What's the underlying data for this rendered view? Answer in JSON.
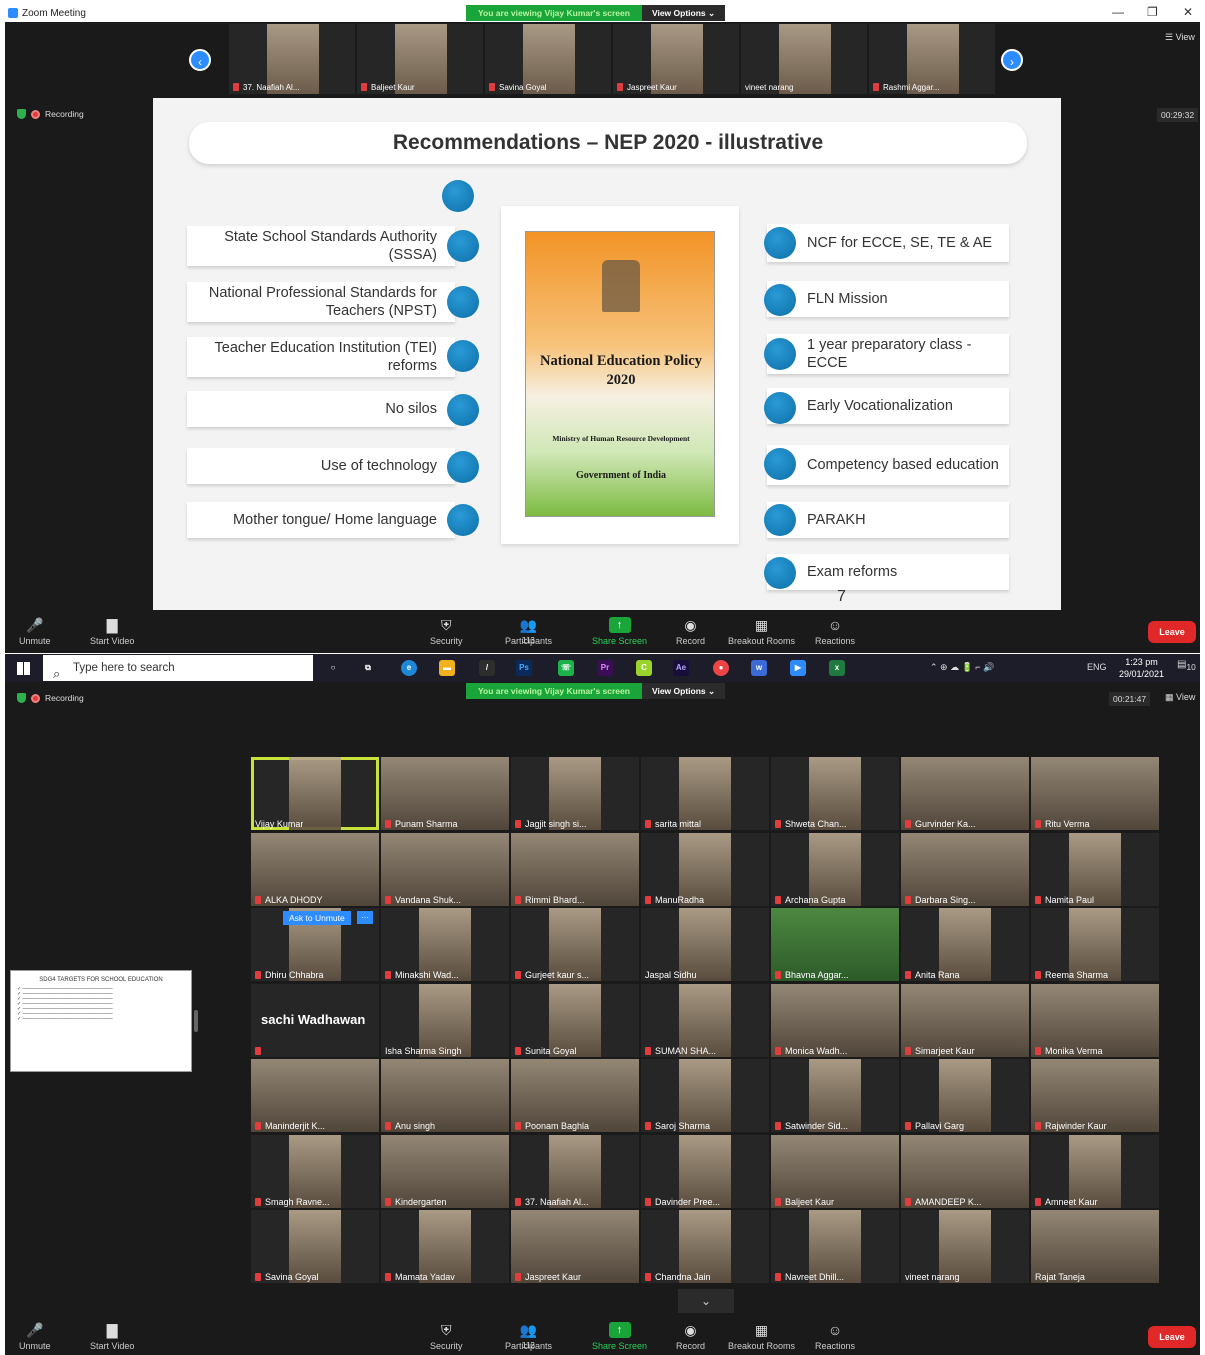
{
  "window": {
    "title": "Zoom Meeting",
    "minimize": "—",
    "restore": "❐",
    "close": "✕"
  },
  "banner": {
    "message": "You are viewing Vijay Kumar's screen",
    "options": "View Options ⌄"
  },
  "top": {
    "view": "View",
    "recording": "Recording",
    "timer": "00:29:32",
    "strip": [
      "37. Naafiah Al...",
      "Baljeet Kaur",
      "Savina Goyal",
      "Jaspreet Kaur",
      "vineet narang",
      "Rashmi Aggar..."
    ]
  },
  "slide": {
    "title": "Recommendations – NEP 2020 - illustrative",
    "left": [
      "State School Standards Authority (SSSA)",
      "National Professional Standards for Teachers (NPST)",
      "Teacher Education Institution (TEI) reforms",
      "No silos",
      "Use of technology",
      "Mother tongue/ Home language"
    ],
    "right": [
      "NCF for ECCE, SE, TE & AE",
      "FLN Mission",
      "1 year preparatory class - ECCE",
      "Early Vocationalization",
      "Competency based education",
      "PARAKH",
      "Exam reforms"
    ],
    "cover": {
      "title": "National Education Policy 2020",
      "ministry": "Ministry of Human Resource Development",
      "govt": "Government of India"
    },
    "page": "7"
  },
  "toolbar_top": {
    "unmute": "Unmute",
    "start_video": "Start Video",
    "security": "Security",
    "participants": "Participants",
    "participants_count": "113",
    "share": "Share Screen",
    "record": "Record",
    "breakout": "Breakout Rooms",
    "reactions": "Reactions",
    "leave": "Leave"
  },
  "taskbar": {
    "search_placeholder": "Type here to search",
    "lang": "ENG",
    "time": "1:23 pm",
    "date": "29/01/2021",
    "notif": "10"
  },
  "bottom": {
    "recording": "Recording",
    "timer": "00:21:47",
    "view": "View",
    "ask_unmute": "Ask to Unmute",
    "more": "···",
    "shared_title": "SDG4 TARGETS FOR SCHOOL EDUCATION",
    "grid": [
      "Vijay Kumar",
      "Punam Sharma",
      "Jagjit singh si...",
      "sarita mittal",
      "Shweta Chan...",
      "Gurvinder Ka...",
      "Ritu Verma",
      "ALKA DHODY",
      "Vandana Shuk...",
      "Rimmi Bhard...",
      "ManuRadha",
      "Archana Gupta",
      "Darbara Sing...",
      "Namita Paul",
      "Dhiru Chhabra",
      "Minakshi Wad...",
      "Gurjeet kaur s...",
      "Jaspal Sidhu",
      "Bhavna Aggar...",
      "Anita Rana",
      "Reema Sharma",
      "Isha Sharma Singh",
      "Sunita Goyal",
      "SUMAN SHA...",
      "Monica Wadh...",
      "Simarjeet Kaur",
      "Monika Verma",
      "sachi Wadhawan",
      "Maninderjit K...",
      "Anu singh",
      "Poonam Baghla",
      "Saroj Sharma",
      "Satwinder Sid...",
      "Pallavi Garg",
      "Rajwinder Kaur",
      "Smagh Ravne...",
      "Kindergarten",
      "37. Naafiah Al...",
      "Davinder Pree...",
      "Baljeet Kaur",
      "AMANDEEP K...",
      "Amneet Kaur",
      "Savina Goyal",
      "Mamata Yadav",
      "Jaspreet Kaur",
      "Chandna Jain",
      "Navreet Dhill...",
      "vineet narang",
      "Rajat Taneja"
    ],
    "participants_count": "112"
  }
}
